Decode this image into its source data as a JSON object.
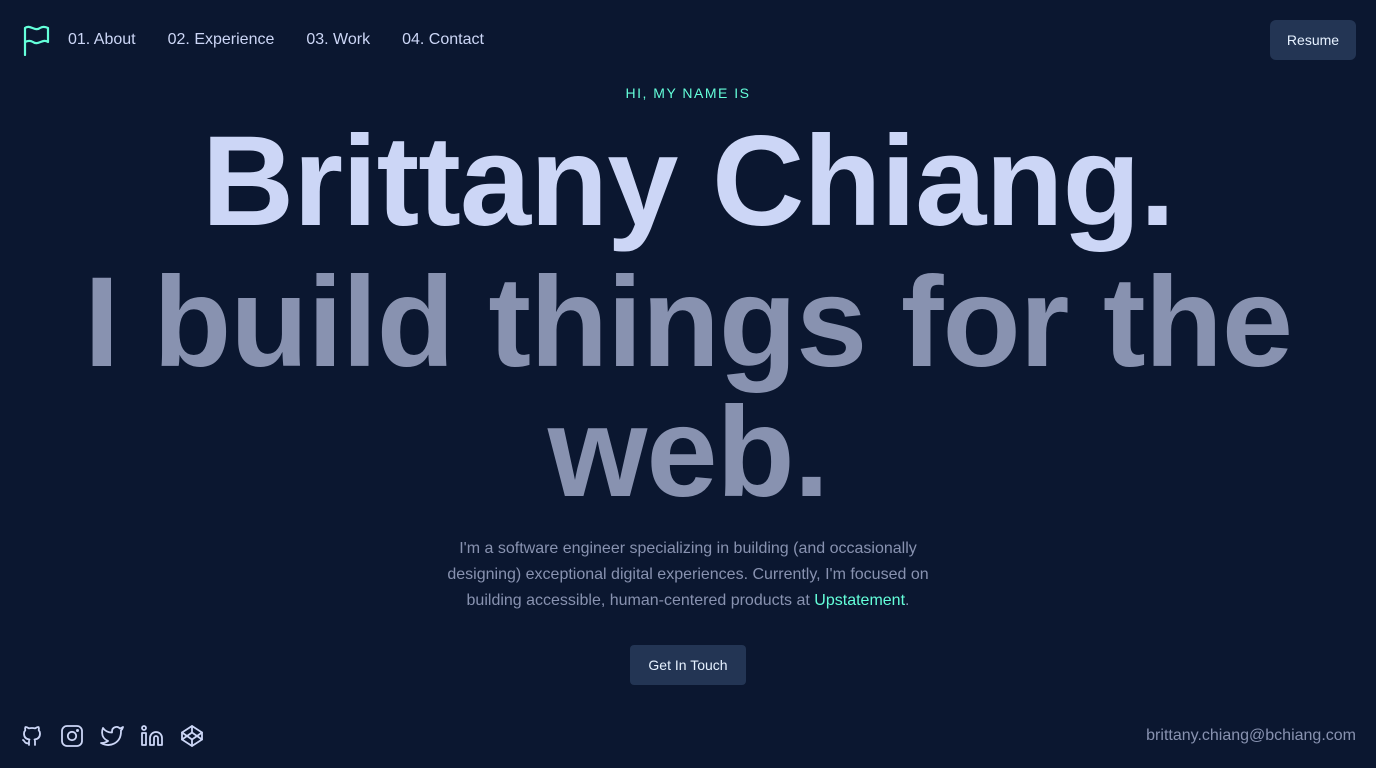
{
  "header": {
    "logo_icon": "flag-icon",
    "nav": [
      {
        "label": "01. About"
      },
      {
        "label": "02. Experience"
      },
      {
        "label": "03. Work"
      },
      {
        "label": "04. Contact"
      }
    ],
    "resume_label": "Resume"
  },
  "hero": {
    "greeting": "HI, MY NAME IS",
    "name": "Brittany Chiang.",
    "tagline": "I build things for the web.",
    "intro_text": "I'm a software engineer specializing in building (and occasionally designing) exceptional digital experiences. Currently, I'm focused on building accessible, human-centered products at ",
    "intro_link": "Upstatement",
    "intro_end": ".",
    "cta_label": "Get In Touch"
  },
  "footer": {
    "socials": [
      {
        "icon": "github-icon"
      },
      {
        "icon": "instagram-icon"
      },
      {
        "icon": "twitter-icon"
      },
      {
        "icon": "linkedin-icon"
      },
      {
        "icon": "codepen-icon"
      }
    ],
    "email": "brittany.chiang@bchiang.com"
  },
  "colors": {
    "background": "#0b1730",
    "accent": "#64ffda",
    "heading": "#ccd6f6",
    "muted": "#8892b0",
    "button": "#233554"
  }
}
